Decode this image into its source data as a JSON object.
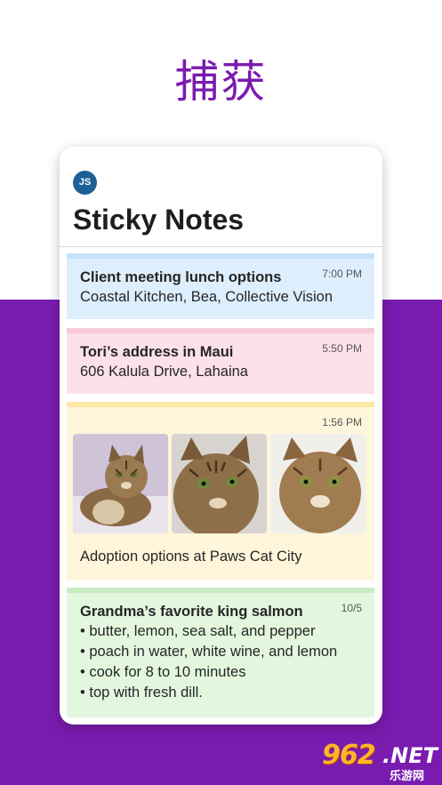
{
  "headline": "捕获",
  "app": {
    "avatar_initials": "JS",
    "title": "Sticky Notes"
  },
  "notes": [
    {
      "time": "7:00 PM",
      "title": "Client meeting lunch options",
      "body": "Coastal Kitchen, Bea, Collective Vision",
      "color": "#ddeefd"
    },
    {
      "time": "5:50 PM",
      "title": "Tori’s address in Maui",
      "body": "606 Kalula Drive, Lahaina",
      "color": "#fde1ea"
    },
    {
      "time": "1:56 PM",
      "images": [
        "cat-photo-1",
        "cat-photo-2",
        "cat-photo-3"
      ],
      "body": "Adoption options at Paws Cat City",
      "color": "#fff5da"
    },
    {
      "time": "10/5",
      "title": "Grandma’s favorite king salmon",
      "items": [
        "• butter, lemon, sea salt, and pepper",
        "• poach in water, white wine, and lemon",
        "• cook for 8 to 10 minutes",
        "• top with fresh dill."
      ],
      "color": "#e3f7df"
    }
  ],
  "watermark": {
    "number": "962",
    "suffix": ".NET",
    "sub": "乐游网"
  },
  "colors": {
    "brand_purple": "#7a1bb0",
    "avatar_blue": "#1d5f96"
  }
}
